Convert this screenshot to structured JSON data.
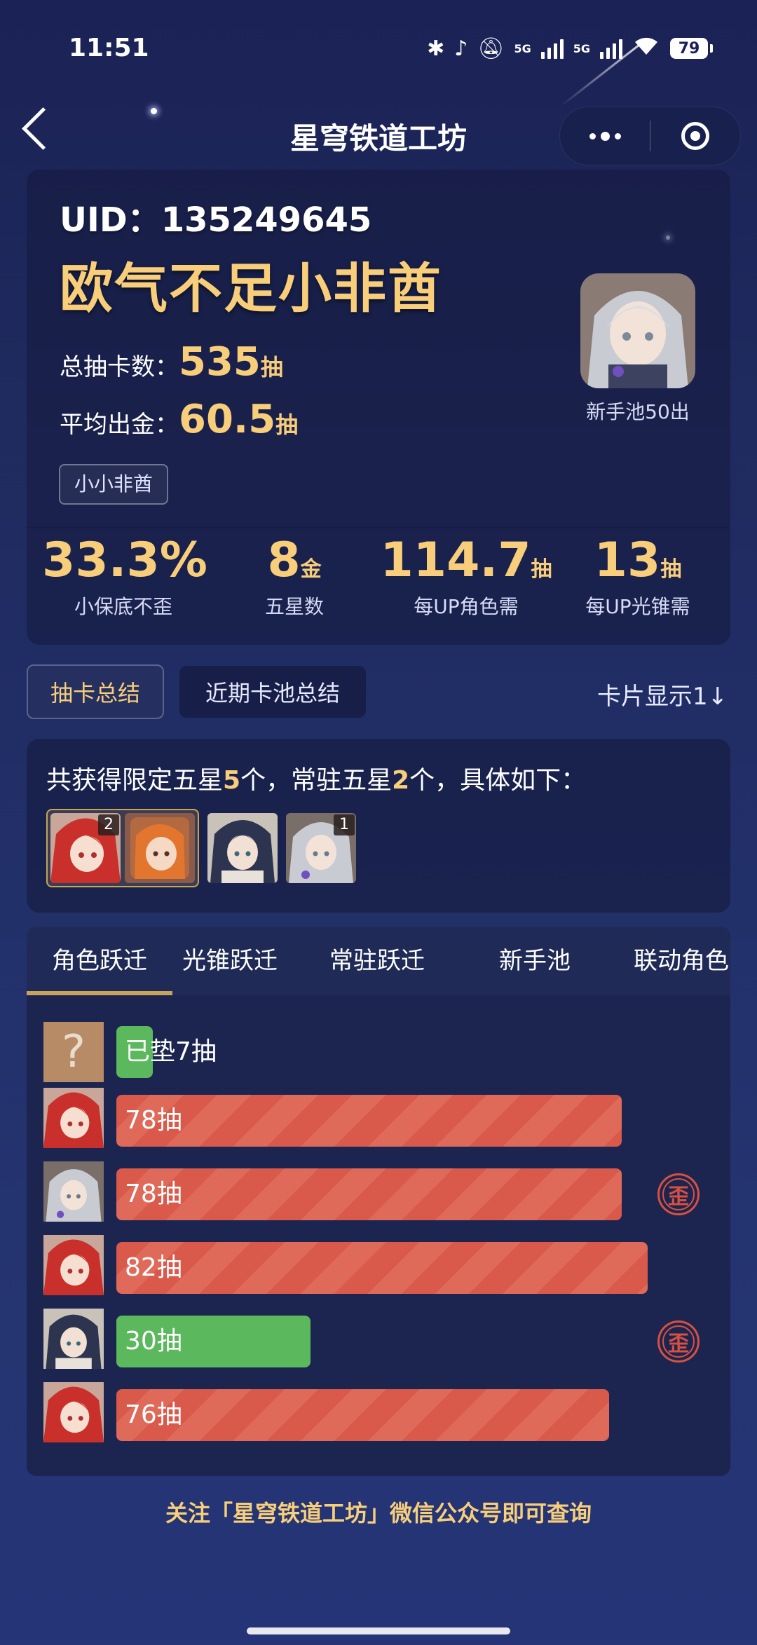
{
  "status_bar": {
    "time": "11:51",
    "network1": "5G",
    "network2": "5G",
    "battery": "79"
  },
  "nav": {
    "title": "星穹铁道工坊"
  },
  "profile": {
    "uid_label": "UID：",
    "uid": "135249645",
    "nickname": "欧气不足小非酋",
    "total_label": "总抽卡数：",
    "total_value": "535",
    "total_unit": "抽",
    "avg_label": "平均出金：",
    "avg_value": "60.5",
    "avg_unit": "抽",
    "badge": "小小非酋",
    "avatar_caption": "新手池50出"
  },
  "stats": [
    {
      "value": "33.3%",
      "unit": "",
      "label": "小保底不歪"
    },
    {
      "value": "8",
      "unit": "金",
      "label": "五星数"
    },
    {
      "value": "114.7",
      "unit": "抽",
      "label": "每UP角色需"
    },
    {
      "value": "13",
      "unit": "抽",
      "label": "每UP光锥需"
    }
  ],
  "tabs": {
    "summary": "抽卡总结",
    "recent": "近期卡池总结",
    "card_toggle": "卡片显示1↓"
  },
  "summary": {
    "prefix": "共获得限定五星",
    "limited_count": "5",
    "mid": "个，常驻五星",
    "standard_count": "2",
    "suffix": "个，具体如下：",
    "thumb_badges": [
      "2",
      "1"
    ]
  },
  "pool_tabs": [
    "角色跃迁",
    "光锥跃迁",
    "常驻跃迁",
    "新手池",
    "联动角色"
  ],
  "pending": {
    "text": "已垫7抽"
  },
  "rows": [
    {
      "label": "78抽",
      "pulls": 78,
      "color": "red",
      "wai": false,
      "char": "red"
    },
    {
      "label": "78抽",
      "pulls": 78,
      "color": "red",
      "wai": true,
      "char": "silver"
    },
    {
      "label": "82抽",
      "pulls": 82,
      "color": "red",
      "wai": false,
      "char": "red"
    },
    {
      "label": "30抽",
      "pulls": 30,
      "color": "green",
      "wai": true,
      "char": "dark"
    },
    {
      "label": "76抽",
      "pulls": 76,
      "color": "red",
      "wai": false,
      "char": "red"
    }
  ],
  "wai_label": "歪",
  "footer": "关注「星穹铁道工坊」微信公众号即可查询",
  "colors": {
    "gold": "#f8ce7a",
    "red_bar": "#d95a4b",
    "green_bar": "#5cb85c",
    "wai": "#d85040"
  }
}
